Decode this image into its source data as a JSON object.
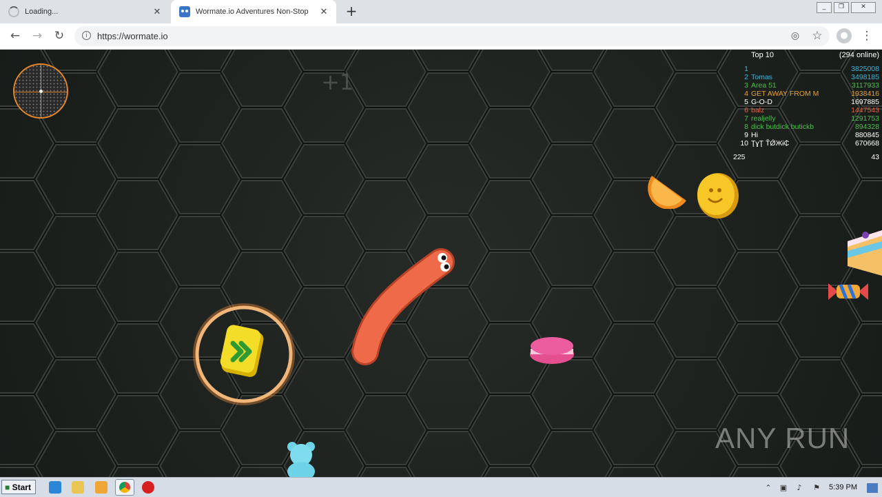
{
  "browser": {
    "tabs": [
      {
        "title": "Loading...",
        "close": "✕"
      },
      {
        "title": "Wormate.io Adventures Non-Stop",
        "close": "✕"
      }
    ],
    "new_tab": "+",
    "url": "https://wormate.io"
  },
  "game": {
    "score_popup": "+1",
    "leaderboard": {
      "title": "Top 10",
      "online": "(294 online)",
      "rows": [
        {
          "rank": "1",
          "name": "",
          "score": "3825008",
          "color": "#35b8e0"
        },
        {
          "rank": "2",
          "name": "Tomas",
          "score": "3498185",
          "color": "#35b8e0"
        },
        {
          "rank": "3",
          "name": "Area 51",
          "score": "3117933",
          "color": "#4fbf4f"
        },
        {
          "rank": "4",
          "name": "GET AWAY FROM M",
          "score": "1938416",
          "color": "#e8a030"
        },
        {
          "rank": "5",
          "name": "G-O-D",
          "score": "1697885",
          "color": "#ffffff"
        },
        {
          "rank": "6",
          "name": "balz",
          "score": "1447543",
          "color": "#e8603a"
        },
        {
          "rank": "7",
          "name": "realjelly",
          "score": "1291753",
          "color": "#4fbf4f"
        },
        {
          "rank": "8",
          "name": "dick butdick butickb",
          "score": "894328",
          "color": "#4fbf4f"
        },
        {
          "rank": "9",
          "name": "Hi",
          "score": "880845",
          "color": "#ffffff"
        },
        {
          "rank": "10",
          "name": "ŢɣŢ ŤǾЖɨ₵",
          "score": "670668",
          "color": "#ffffff"
        }
      ],
      "my_rank": "225",
      "my_score": "43"
    },
    "watermark": "ANY RUN"
  },
  "taskbar": {
    "start": "Start",
    "clock": "5:39 PM"
  }
}
